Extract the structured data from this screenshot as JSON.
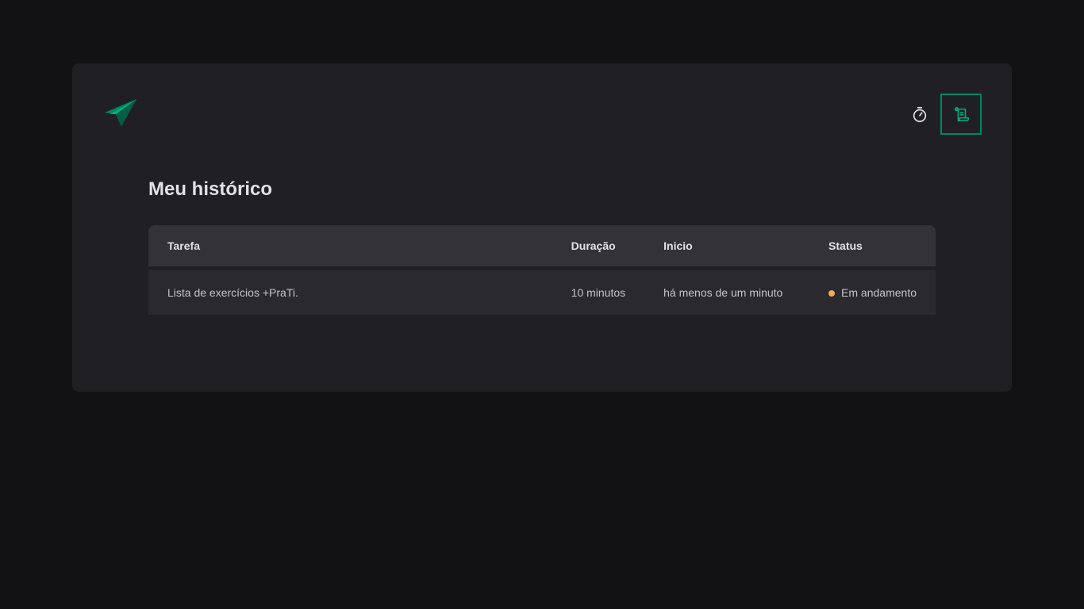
{
  "colors": {
    "background": "#121214",
    "panel": "#202024",
    "accent": "#00875f",
    "status_in_progress": "#fba94c"
  },
  "header": {
    "logo_icon": "paper-plane-logo-icon",
    "nav": [
      {
        "icon": "timer-icon",
        "active": false
      },
      {
        "icon": "scroll-icon",
        "active": true
      }
    ]
  },
  "history": {
    "title": "Meu histórico",
    "columns": {
      "task": "Tarefa",
      "duration": "Duração",
      "start": "Inicio",
      "status": "Status"
    },
    "rows": [
      {
        "task": "Lista de exercícios +PraTi.",
        "duration": "10 minutos",
        "start": "há menos de um minuto",
        "status": "Em andamento"
      }
    ]
  }
}
